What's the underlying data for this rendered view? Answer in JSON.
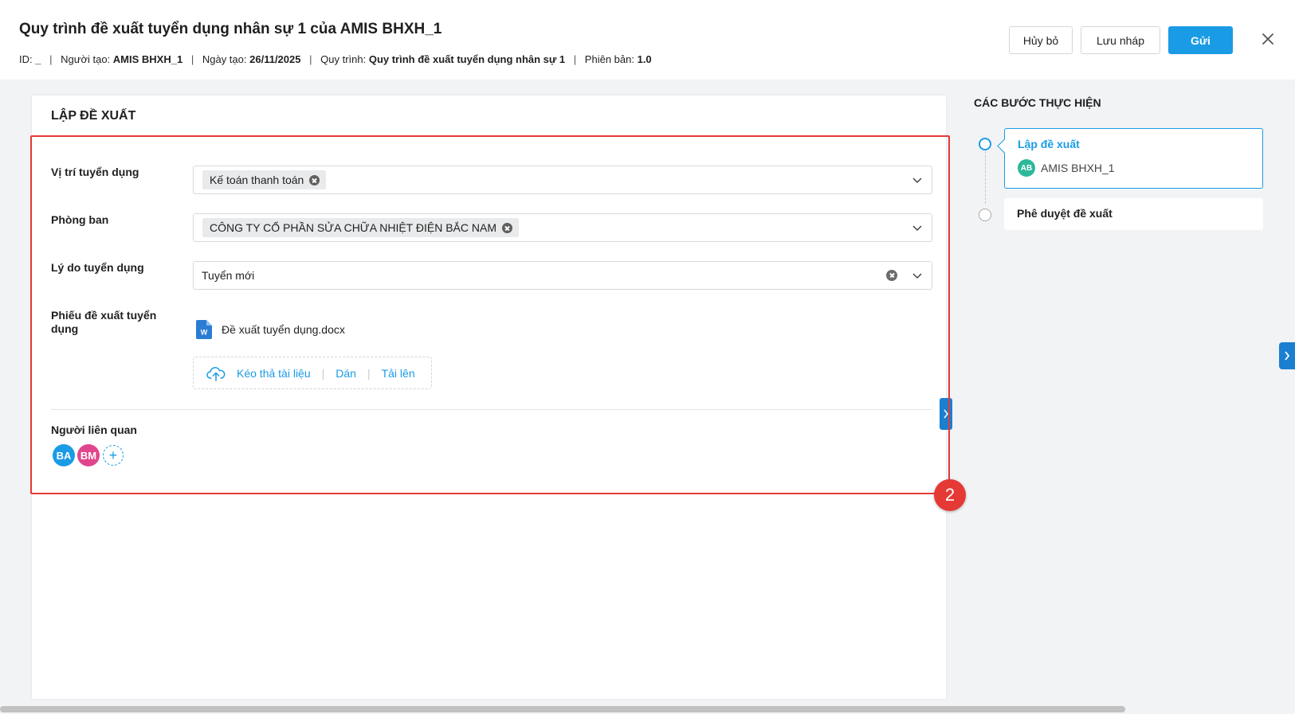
{
  "header": {
    "title": "Quy trình đề xuất tuyển dụng nhân sự 1 của AMIS BHXH_1",
    "meta": {
      "id_label": "ID:",
      "id_value": "_",
      "creator_label": "Người tạo:",
      "creator_value": "AMIS BHXH_1",
      "date_label": "Ngày tạo:",
      "date_value": "26/11/2025",
      "process_label": "Quy trình:",
      "process_value": "Quy trình đề xuất tuyển dụng nhân sự 1",
      "version_label": "Phiên bản:",
      "version_value": "1.0",
      "separator": "|"
    },
    "buttons": {
      "cancel": "Hủy bỏ",
      "draft": "Lưu nháp",
      "send": "Gửi"
    }
  },
  "form": {
    "section_title": "LẬP ĐỀ XUẤT",
    "position": {
      "label": "Vị trí tuyển dụng",
      "chip": "Kế toán thanh toán"
    },
    "department": {
      "label": "Phòng ban",
      "chip": "CÔNG TY CỔ PHẦN SỬA CHỮA NHIỆT ĐIỆN BẮC NAM"
    },
    "reason": {
      "label": "Lý do tuyển dụng",
      "value": "Tuyển mới"
    },
    "attachment": {
      "label": "Phiếu đề xuất tuyển dụng",
      "file_name": "Đề xuất tuyển dụng.docx",
      "file_icon_letter": "W",
      "upload_drag": "Kéo thả tài liệu",
      "upload_paste": "Dán",
      "upload_upload": "Tải lên",
      "upload_sep": "|"
    },
    "related": {
      "label": "Người liên quan",
      "people": [
        {
          "initials": "BA",
          "color": "#1a9be6"
        },
        {
          "initials": "BM",
          "color": "#e0468c"
        }
      ],
      "add_symbol": "+"
    }
  },
  "annotation": {
    "badge": "2",
    "color": "#e53935"
  },
  "steps": {
    "title": "CÁC BƯỚC THỰC HIỆN",
    "items": [
      {
        "name": "Lập đề xuất",
        "user_initials": "AB",
        "user": "AMIS BHXH_1",
        "active": true
      },
      {
        "name": "Phê duyệt đề xuất",
        "active": false
      }
    ]
  },
  "colors": {
    "accent": "#1a9be6",
    "highlight": "#e53935",
    "avatar_step": "#2db89c"
  }
}
